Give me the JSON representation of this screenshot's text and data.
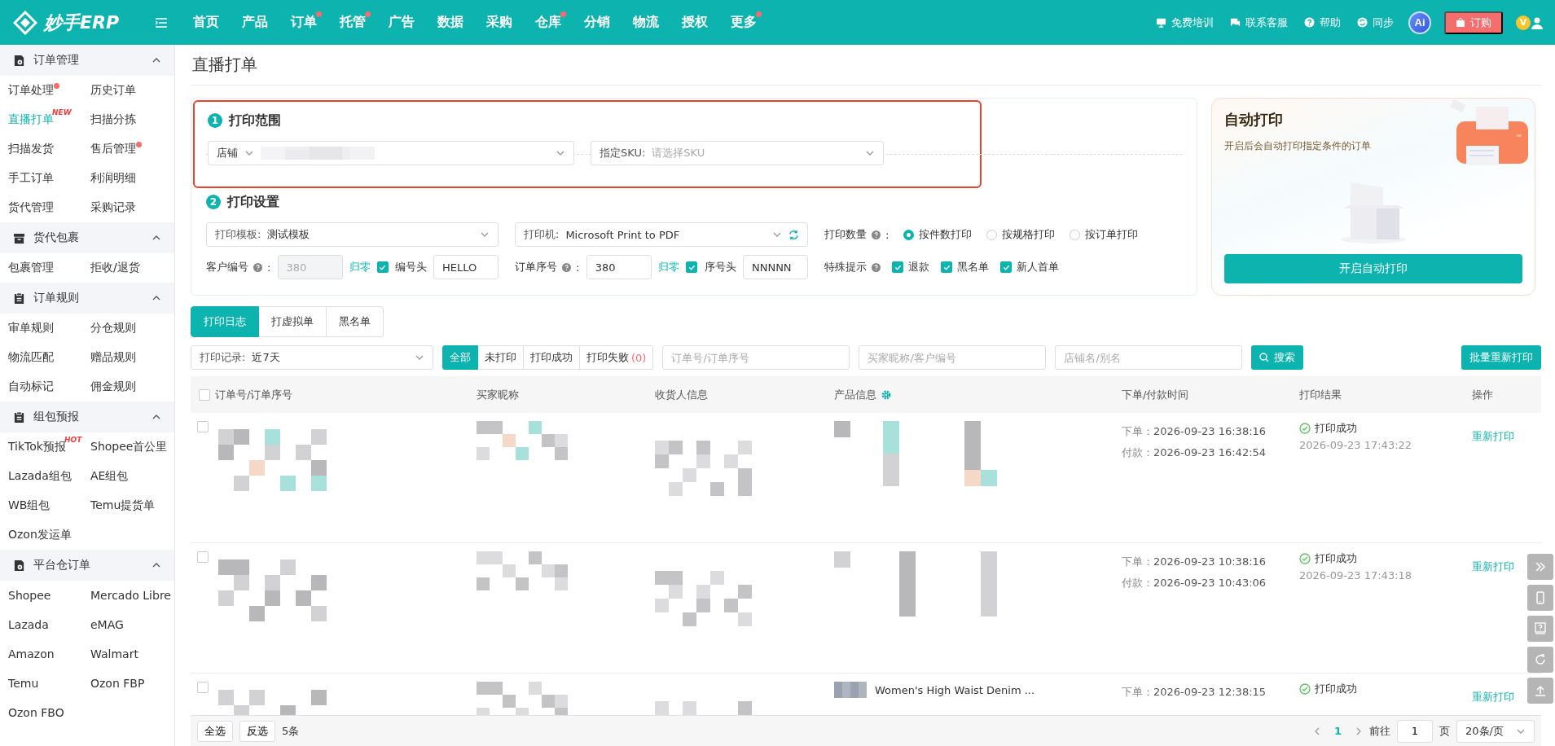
{
  "brand": {
    "name": "妙手ERP"
  },
  "nav": [
    {
      "label": "首页",
      "dot": false
    },
    {
      "label": "产品",
      "dot": false
    },
    {
      "label": "订单",
      "dot": true
    },
    {
      "label": "托管",
      "dot": true
    },
    {
      "label": "广告",
      "dot": false
    },
    {
      "label": "数据",
      "dot": false
    },
    {
      "label": "采购",
      "dot": false
    },
    {
      "label": "仓库",
      "dot": true
    },
    {
      "label": "分销",
      "dot": false
    },
    {
      "label": "物流",
      "dot": false
    },
    {
      "label": "授权",
      "dot": false
    },
    {
      "label": "更多",
      "dot": true
    }
  ],
  "header_actions": [
    {
      "kind": "training",
      "label": "免费培训"
    },
    {
      "kind": "service",
      "label": "联系客服"
    },
    {
      "kind": "help",
      "label": "帮助"
    },
    {
      "kind": "sync",
      "label": "同步"
    }
  ],
  "ai_button": "Ai",
  "subscribe_button": "订购",
  "vip_badge": "V",
  "sidebar": {
    "groups": [
      {
        "title": "订单管理",
        "kind": "gear-doc",
        "expanded": true,
        "items": [
          {
            "label": "订单处理",
            "selected": false,
            "dot": true
          },
          {
            "label": "历史订单",
            "selected": false
          },
          {
            "label": "直播打单",
            "selected": true,
            "badge": "NEW"
          },
          {
            "label": "扫描分拣",
            "selected": false
          },
          {
            "label": "扫描发货",
            "selected": false
          },
          {
            "label": "售后管理",
            "selected": false,
            "dot": true
          },
          {
            "label": "手工订单",
            "selected": false
          },
          {
            "label": "利润明细",
            "selected": false
          },
          {
            "label": "货代管理",
            "selected": false
          },
          {
            "label": "采购记录",
            "selected": false
          }
        ]
      },
      {
        "title": "货代包裹",
        "kind": "box",
        "expanded": true,
        "items": [
          {
            "label": "包裹管理",
            "selected": false
          },
          {
            "label": "拒收/退货",
            "selected": false
          }
        ]
      },
      {
        "title": "订单规则",
        "kind": "clipboard",
        "expanded": true,
        "items": [
          {
            "label": "审单规则",
            "selected": false
          },
          {
            "label": "分仓规则",
            "selected": false
          },
          {
            "label": "物流匹配",
            "selected": false
          },
          {
            "label": "赠品规则",
            "selected": false
          },
          {
            "label": "自动标记",
            "selected": false
          },
          {
            "label": "佣金规则",
            "selected": false
          }
        ]
      },
      {
        "title": "组包预报",
        "kind": "clipboard",
        "expanded": true,
        "items": [
          {
            "label": "TikTok预报",
            "selected": false,
            "badge": "HOT"
          },
          {
            "label": "Shopee首公里",
            "selected": false
          },
          {
            "label": "Lazada组包",
            "selected": false
          },
          {
            "label": "AE组包",
            "selected": false
          },
          {
            "label": "WB组包",
            "selected": false
          },
          {
            "label": "Temu提货单",
            "selected": false
          },
          {
            "label": "Ozon发运单",
            "selected": false
          }
        ]
      },
      {
        "title": "平台仓订单",
        "kind": "gear-doc",
        "expanded": true,
        "items": [
          {
            "label": "Shopee",
            "selected": false
          },
          {
            "label": "Mercado Libre",
            "selected": false
          },
          {
            "label": "Lazada",
            "selected": false
          },
          {
            "label": "eMAG",
            "selected": false
          },
          {
            "label": "Amazon",
            "selected": false
          },
          {
            "label": "Walmart",
            "selected": false
          },
          {
            "label": "Temu",
            "selected": false
          },
          {
            "label": "Ozon FBP",
            "selected": false
          },
          {
            "label": "Ozon FBO",
            "selected": false
          }
        ]
      }
    ]
  },
  "page_title": "直播打单",
  "print_scope": {
    "step": "1",
    "title": "打印范围",
    "store": {
      "label": "店铺"
    },
    "sku": {
      "label": "指定SKU:",
      "placeholder": "请选择SKU"
    }
  },
  "print_settings": {
    "step": "2",
    "title": "打印设置",
    "template": {
      "label": "打印模板:",
      "value": "测试模板"
    },
    "printer": {
      "label": "打印机:",
      "value": "Microsoft Print to PDF"
    },
    "quantity": {
      "label": "打印数量",
      "suffix": ":",
      "options": [
        {
          "label": "按件数打印",
          "selected": true
        },
        {
          "label": "按规格打印",
          "selected": false
        },
        {
          "label": "按订单打印",
          "selected": false
        }
      ]
    },
    "customer_no": {
      "label": "客户编号",
      "suffix": ":",
      "value": "380",
      "disabled": true,
      "reset": "归零",
      "check": {
        "label": "编号头",
        "checked": true
      },
      "prefix": "HELLO"
    },
    "order_seq": {
      "label": "订单序号",
      "suffix": ":",
      "value": "380",
      "disabled": false,
      "reset": "归零",
      "check": {
        "label": "序号头",
        "checked": true
      },
      "prefix": "NNNNN"
    },
    "special": {
      "label": "特殊提示",
      "options": [
        {
          "label": "退款",
          "checked": true
        },
        {
          "label": "黑名单",
          "checked": true
        },
        {
          "label": "新人首单",
          "checked": true
        }
      ]
    }
  },
  "auto_print": {
    "title": "自动打印",
    "subtitle": "开启后会自动打印指定条件的订单",
    "button": "开启自动打印"
  },
  "log_tabs": [
    {
      "label": "打印日志",
      "selected": true
    },
    {
      "label": "打虚拟单",
      "selected": false
    },
    {
      "label": "黑名单",
      "selected": false
    }
  ],
  "filters": {
    "record": {
      "label": "打印记录:",
      "value": "近7天"
    },
    "status_tabs": [
      {
        "label": "全部",
        "selected": true
      },
      {
        "label": "未打印",
        "selected": false
      },
      {
        "label": "打印成功",
        "selected": false
      },
      {
        "label": "打印失败",
        "selected": false,
        "count": "(0)"
      }
    ],
    "search_fields": [
      {
        "placeholder": "订单号/订单序号"
      },
      {
        "placeholder": "买家昵称/客户编号"
      },
      {
        "placeholder": "店铺名/别名"
      }
    ],
    "search_button": "搜索",
    "batch_button": "批量重新打印"
  },
  "table": {
    "select_all_checked": false,
    "columns": [
      {
        "label": "订单号/订单序号"
      },
      {
        "label": "买家昵称"
      },
      {
        "label": "收货人信息"
      },
      {
        "label": "产品信息",
        "settings": true
      },
      {
        "label": "下单/付款时间"
      },
      {
        "label": "打印结果"
      },
      {
        "label": "操作"
      }
    ],
    "rows": [
      {
        "checked": false,
        "order_label": "下单：",
        "order_time": "2026-09-23 16:38:16",
        "pay_label": "付款：",
        "pay_time": "2026-09-23 16:42:54",
        "status": "打印成功",
        "printed_at": "2026-09-23 17:43:22",
        "action": "重新打印"
      },
      {
        "checked": false,
        "order_label": "下单：",
        "order_time": "2026-09-23 10:38:16",
        "pay_label": "付款：",
        "pay_time": "2026-09-23 10:43:06",
        "status": "打印成功",
        "printed_at": "2026-09-23 17:43:18",
        "action": "重新打印"
      },
      {
        "checked": false,
        "order_label": "下单：",
        "order_time": "2026-09-23 12:38:15",
        "status": "打印成功",
        "action": "重新打印",
        "product_title": "Women's High Waist Denim ..."
      }
    ]
  },
  "footer": {
    "select_all": "全选",
    "invert": "反选",
    "count": "5条",
    "pages": [
      {
        "label": "1",
        "selected": true
      }
    ],
    "goto_label": "前往",
    "goto_value": "1",
    "page_unit": "页",
    "page_size": "20条/页"
  },
  "float_tools": [
    {
      "kind": "collapse"
    },
    {
      "kind": "mobile"
    },
    {
      "kind": "help"
    },
    {
      "kind": "refresh"
    },
    {
      "kind": "top"
    }
  ]
}
